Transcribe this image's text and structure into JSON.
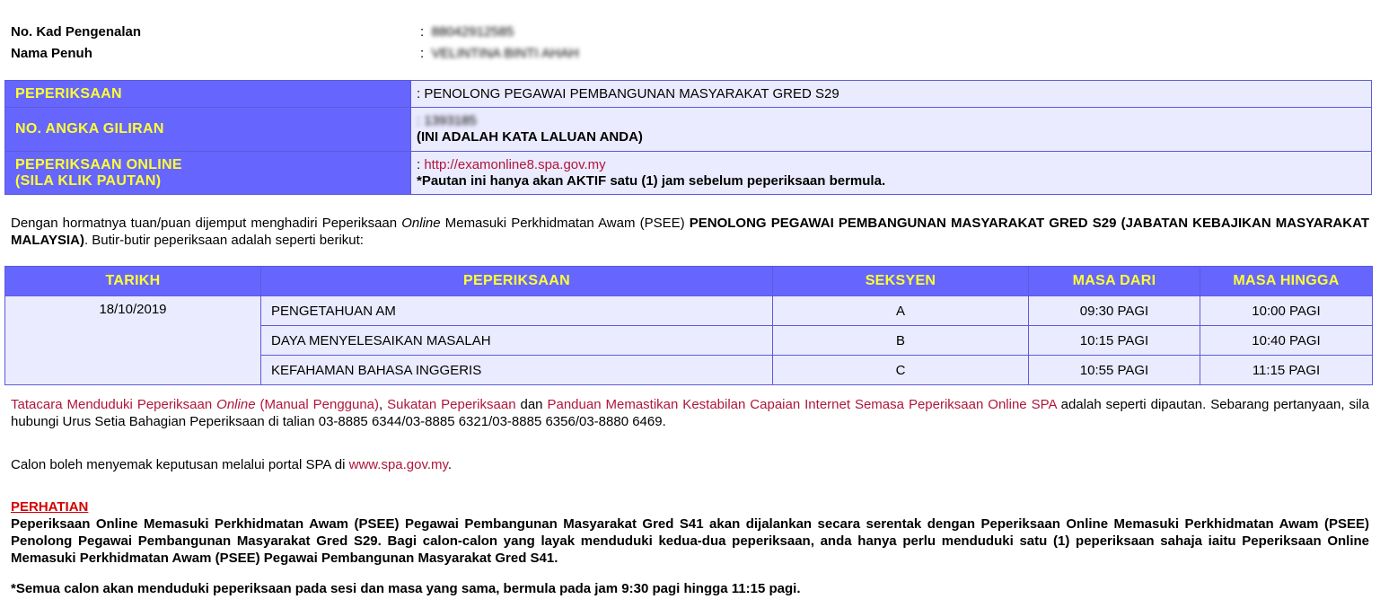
{
  "identity": {
    "ic_label": "No. Kad Pengenalan",
    "ic_value": "88042912585",
    "name_label": "Nama Penuh",
    "name_value": "VELINTINA BINTI AHAH"
  },
  "info": {
    "exam_label": "PEPERIKSAAN",
    "exam_value": ": PENOLONG PEGAWAI PEMBANGUNAN MASYARAKAT GRED S29",
    "roll_label": "NO. ANGKA GILIRAN",
    "roll_value": ": 1393185",
    "roll_note": "(INI ADALAH KATA LALUAN ANDA)",
    "online_label_line1": "PEPERIKSAAN ONLINE",
    "online_label_line2": "(SILA KLIK PAUTAN)",
    "online_prefix": ": ",
    "online_link": "http://examonline8.spa.gov.my",
    "online_note": "*Pautan ini hanya akan AKTIF satu (1) jam sebelum peperiksaan bermula."
  },
  "intro": {
    "text1": "Dengan hormatnya tuan/puan dijemput menghadiri Peperiksaan ",
    "online_word": "Online",
    "text2": " Memasuki Perkhidmatan Awam (PSEE) ",
    "bold_text": "PENOLONG PEGAWAI PEMBANGUNAN MASYARAKAT GRED S29 (JABATAN KEBAJIKAN MASYARAKAT MALAYSIA)",
    "text3": ". Butir-butir peperiksaan adalah seperti berikut:"
  },
  "schedule": {
    "headers": [
      "TARIKH",
      "PEPERIKSAAN",
      "SEKSYEN",
      "MASA DARI",
      "MASA HINGGA"
    ],
    "date": "18/10/2019",
    "rows": [
      {
        "subject": "PENGETAHUAN AM",
        "section": "A",
        "from": "09:30 PAGI",
        "to": "10:00 PAGI"
      },
      {
        "subject": "DAYA MENYELESAIKAN MASALAH",
        "section": "B",
        "from": "10:15 PAGI",
        "to": "10:40 PAGI"
      },
      {
        "subject": "KEFAHAMAN BAHASA INGGERIS",
        "section": "C",
        "from": "10:55 PAGI",
        "to": "11:15 PAGI"
      }
    ]
  },
  "links_para": {
    "link1a": "Tatacara Menduduki Peperiksaan ",
    "link1b": "Online",
    "link1c": " (Manual Pengguna)",
    "sep1": ", ",
    "link2": "Sukatan Peperiksaan",
    "sep2": " dan ",
    "link3": "Panduan Memastikan Kestabilan Capaian Internet Semasa Peperiksaan Online SPA",
    "text": " adalah seperti dipautan. Sebarang pertanyaan, sila hubungi Urus Setia Bahagian Peperiksaan di talian 03-8885 6344/03-8885 6321/03-8885 6356/03-8880 6469."
  },
  "results_para": {
    "text": "Calon boleh menyemak keputusan melalui portal SPA di ",
    "link": "www.spa.gov.my",
    "end": "."
  },
  "notice": {
    "heading": "PERHATIAN",
    "body": "Peperiksaan Online Memasuki Perkhidmatan Awam (PSEE) Pegawai Pembangunan Masyarakat Gred S41 akan dijalankan secara serentak dengan Peperiksaan Online Memasuki Perkhidmatan Awam (PSEE) Penolong Pegawai Pembangunan Masyarakat Gred S29. Bagi calon-calon yang layak menduduki kedua-dua peperiksaan, anda hanya perlu menduduki satu (1) peperiksaan sahaja iaitu Peperiksaan Online Memasuki Perkhidmatan Awam (PSEE) Pegawai Pembangunan Masyarakat Gred S41.",
    "footnote": "*Semua calon akan menduduki peperiksaan pada sesi dan masa yang sama, bermula pada jam 9:30 pagi hingga 11:15 pagi."
  }
}
